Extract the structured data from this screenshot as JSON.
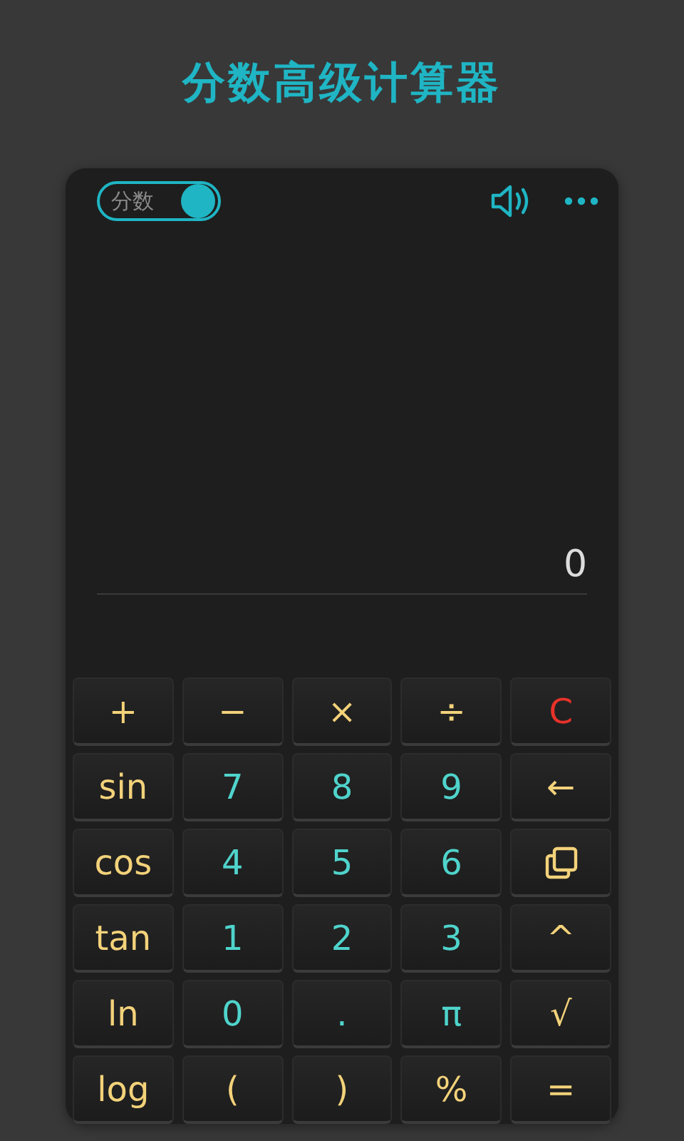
{
  "title": "分数高级计算器",
  "toolbar": {
    "toggle": {
      "label": "分数",
      "on": true
    }
  },
  "display": {
    "value": "0"
  },
  "keys": [
    {
      "kind": "text",
      "label": "+",
      "color": "#f3d27a"
    },
    {
      "kind": "text",
      "label": "−",
      "color": "#f3d27a"
    },
    {
      "kind": "text",
      "label": "×",
      "color": "#f3d27a"
    },
    {
      "kind": "text",
      "label": "÷",
      "color": "#f3d27a"
    },
    {
      "kind": "text",
      "label": "C",
      "color": "#e8322a"
    },
    {
      "kind": "text",
      "label": "sin",
      "color": "#f3d27a"
    },
    {
      "kind": "text",
      "label": "7",
      "color": "#4fd4cc"
    },
    {
      "kind": "text",
      "label": "8",
      "color": "#4fd4cc"
    },
    {
      "kind": "text",
      "label": "9",
      "color": "#4fd4cc"
    },
    {
      "kind": "text",
      "label": "←",
      "color": "#f3d27a"
    },
    {
      "kind": "text",
      "label": "cos",
      "color": "#f3d27a"
    },
    {
      "kind": "text",
      "label": "4",
      "color": "#4fd4cc"
    },
    {
      "kind": "text",
      "label": "5",
      "color": "#4fd4cc"
    },
    {
      "kind": "text",
      "label": "6",
      "color": "#4fd4cc"
    },
    {
      "kind": "copy",
      "color": "#f3d27a"
    },
    {
      "kind": "text",
      "label": "tan",
      "color": "#f3d27a"
    },
    {
      "kind": "text",
      "label": "1",
      "color": "#4fd4cc"
    },
    {
      "kind": "text",
      "label": "2",
      "color": "#4fd4cc"
    },
    {
      "kind": "text",
      "label": "3",
      "color": "#4fd4cc"
    },
    {
      "kind": "text",
      "label": "^",
      "color": "#f3d27a"
    },
    {
      "kind": "text",
      "label": "ln",
      "color": "#f3d27a"
    },
    {
      "kind": "text",
      "label": "0",
      "color": "#4fd4cc"
    },
    {
      "kind": "text",
      "label": ".",
      "color": "#4fd4cc"
    },
    {
      "kind": "text",
      "label": "π",
      "color": "#4fd4cc"
    },
    {
      "kind": "text",
      "label": "√",
      "color": "#f3d27a"
    },
    {
      "kind": "text",
      "label": "log",
      "color": "#f3d27a"
    },
    {
      "kind": "text",
      "label": "(",
      "color": "#f3d27a"
    },
    {
      "kind": "text",
      "label": ")",
      "color": "#f3d27a"
    },
    {
      "kind": "text",
      "label": "%",
      "color": "#f3d27a"
    },
    {
      "kind": "text",
      "label": "=",
      "color": "#f3d27a"
    }
  ]
}
